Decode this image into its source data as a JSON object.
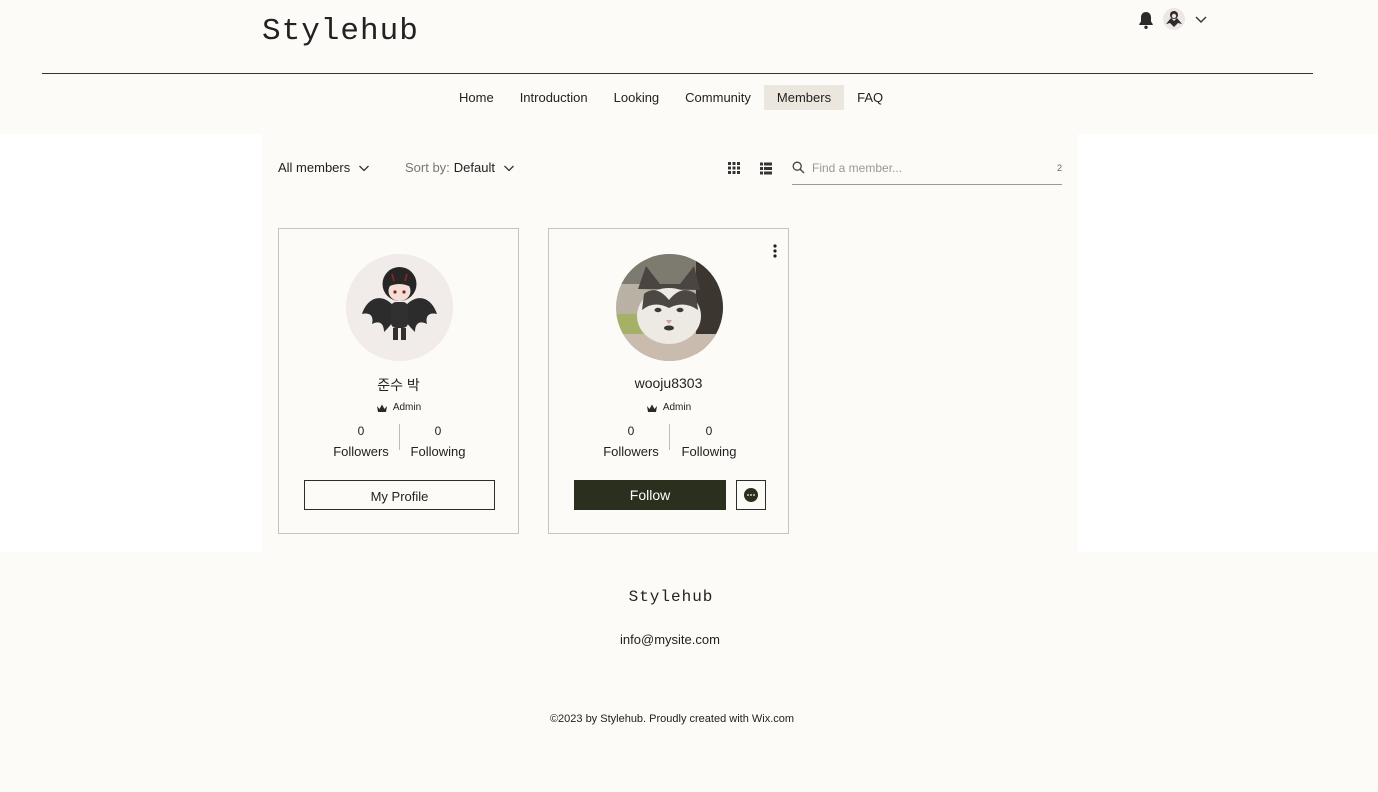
{
  "header": {
    "logo": "Stylehub",
    "nav": [
      "Home",
      "Introduction",
      "Looking",
      "Community",
      "Members",
      "FAQ"
    ],
    "active_nav": "Members"
  },
  "toolbar": {
    "filter_label": "All members",
    "sort_prefix": "Sort by:",
    "sort_value": "Default",
    "search_placeholder": "Find a member...",
    "member_count": "2"
  },
  "members": [
    {
      "name": "준수 박",
      "role": "Admin",
      "followers_count": "0",
      "followers_label": "Followers",
      "following_count": "0",
      "following_label": "Following",
      "button": "My Profile"
    },
    {
      "name": "wooju8303",
      "role": "Admin",
      "followers_count": "0",
      "followers_label": "Followers",
      "following_count": "0",
      "following_label": "Following",
      "button": "Follow"
    }
  ],
  "footer": {
    "logo": "Stylehub",
    "email": "info@mysite.com",
    "copyright": "©2023 by Stylehub. Proudly created with Wix.com"
  },
  "colors": {
    "background": "#fcfbf7",
    "accent_dark": "#2b2f1e",
    "nav_active": "#ebe7df"
  },
  "icons": [
    "bell-icon",
    "avatar-icon",
    "chevron-down-icon",
    "grid-view-icon",
    "list-view-icon",
    "search-icon",
    "crown-icon",
    "more-icon",
    "chat-icon"
  ]
}
